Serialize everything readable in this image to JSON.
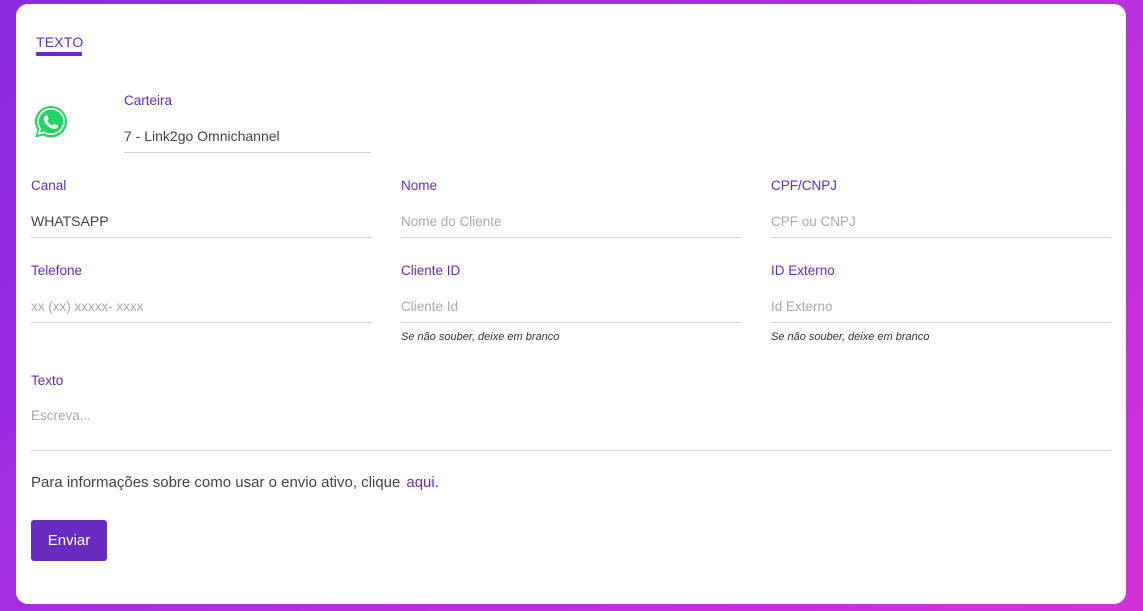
{
  "tabs": [
    {
      "label": "TEXTO",
      "active": true
    }
  ],
  "wallet": {
    "label": "Carteira",
    "value": "7 - Link2go Omnichannel"
  },
  "fields": {
    "canal": {
      "label": "Canal",
      "value": "WHATSAPP"
    },
    "nome": {
      "label": "Nome",
      "placeholder": "Nome do Cliente"
    },
    "cpf": {
      "label": "CPF/CNPJ",
      "placeholder": "CPF ou CNPJ"
    },
    "telefone": {
      "label": "Telefone",
      "placeholder": "xx (xx) xxxxx- xxxx"
    },
    "cliente_id": {
      "label": "Cliente ID",
      "placeholder": "Cliente Id",
      "hint": "Se não souber, deixe em branco"
    },
    "id_externo": {
      "label": "ID Externo",
      "placeholder": "Id Externo",
      "hint": "Se não souber, deixe em branco"
    },
    "texto": {
      "label": "Texto",
      "placeholder": "Escreva..."
    }
  },
  "info": {
    "text": "Para informações sobre como usar o envio ativo, clique",
    "link": "aqui."
  },
  "submit_label": "Enviar",
  "colors": {
    "accent": "#6a2bc0",
    "whatsapp": "#25d366"
  },
  "icons": {
    "channel": "whatsapp-icon"
  }
}
